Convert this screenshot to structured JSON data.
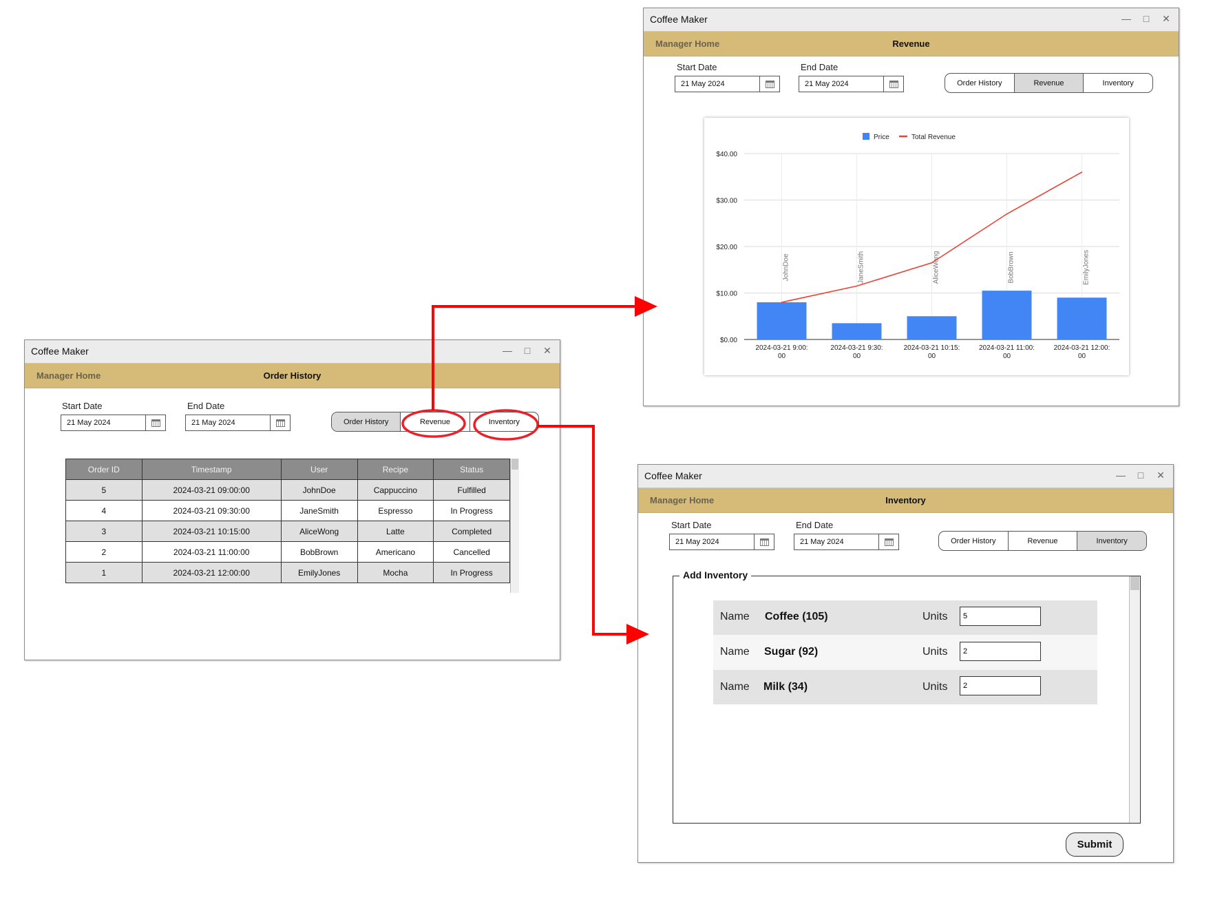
{
  "windows": {
    "order_history": {
      "app_title": "Coffee Maker",
      "nav_home": "Manager Home",
      "page_title": "Order History",
      "start_label": "Start Date",
      "start_value": "21 May 2024",
      "end_label": "End Date",
      "end_value": "21 May 2024",
      "tabs": [
        "Order History",
        "Revenue",
        "Inventory"
      ],
      "active_tab": "Order History",
      "table": {
        "headers": [
          "Order ID",
          "Timestamp",
          "User",
          "Recipe",
          "Status"
        ],
        "rows": [
          [
            "5",
            "2024-03-21 09:00:00",
            "JohnDoe",
            "Cappuccino",
            "Fulfilled"
          ],
          [
            "4",
            "2024-03-21 09:30:00",
            "JaneSmith",
            "Espresso",
            "In Progress"
          ],
          [
            "3",
            "2024-03-21 10:15:00",
            "AliceWong",
            "Latte",
            "Completed"
          ],
          [
            "2",
            "2024-03-21 11:00:00",
            "BobBrown",
            "Americano",
            "Cancelled"
          ],
          [
            "1",
            "2024-03-21 12:00:00",
            "EmilyJones",
            "Mocha",
            "In Progress"
          ]
        ]
      }
    },
    "revenue": {
      "app_title": "Coffee Maker",
      "nav_home": "Manager Home",
      "page_title": "Revenue",
      "start_label": "Start Date",
      "start_value": "21 May 2024",
      "end_label": "End Date",
      "end_value": "21 May 2024",
      "tabs": [
        "Order History",
        "Revenue",
        "Inventory"
      ],
      "active_tab": "Revenue"
    },
    "inventory": {
      "app_title": "Coffee Maker",
      "nav_home": "Manager Home",
      "page_title": "Inventory",
      "start_label": "Start Date",
      "start_value": "21 May 2024",
      "end_label": "End Date",
      "end_value": "21 May 2024",
      "tabs": [
        "Order History",
        "Revenue",
        "Inventory"
      ],
      "active_tab": "Inventory",
      "section_title": "Add Inventory",
      "name_label": "Name",
      "units_label": "Units",
      "items": [
        {
          "name": "Coffee (105)",
          "units": "5"
        },
        {
          "name": "Sugar (92)",
          "units": "2"
        },
        {
          "name": "Milk (34)",
          "units": "2"
        }
      ],
      "submit_label": "Submit"
    }
  },
  "chart_data": {
    "type": "bar",
    "categories": [
      "2024-03-21 9:00:00",
      "2024-03-21 9:30:00",
      "2024-03-21 10:15:00",
      "2024-03-21 11:00:00",
      "2024-03-21 12:00:00"
    ],
    "bar_labels": [
      "JohnDoe",
      "JaneSmith",
      "AliceWong",
      "BobBrown",
      "EmilyJones"
    ],
    "series": [
      {
        "name": "Price",
        "kind": "bar",
        "color": "#4285f4",
        "values": [
          8.0,
          3.5,
          5.0,
          10.5,
          9.0
        ]
      },
      {
        "name": "Total Revenue",
        "kind": "line",
        "color": "#ea4335",
        "values": [
          8.0,
          11.5,
          16.5,
          27.0,
          36.0
        ]
      }
    ],
    "y_ticks": [
      "$0.00",
      "$10.00",
      "$20.00",
      "$30.00",
      "$40.00"
    ],
    "ylim": [
      0,
      40
    ],
    "legend_position": "top",
    "grid": true
  },
  "colors": {
    "nav_bar": "#d5ba78",
    "arrow": "#ff0000",
    "highlight_circle": "#e8212b",
    "table_header": "#8c8c8c",
    "active_tab": "#d9d9d9"
  }
}
